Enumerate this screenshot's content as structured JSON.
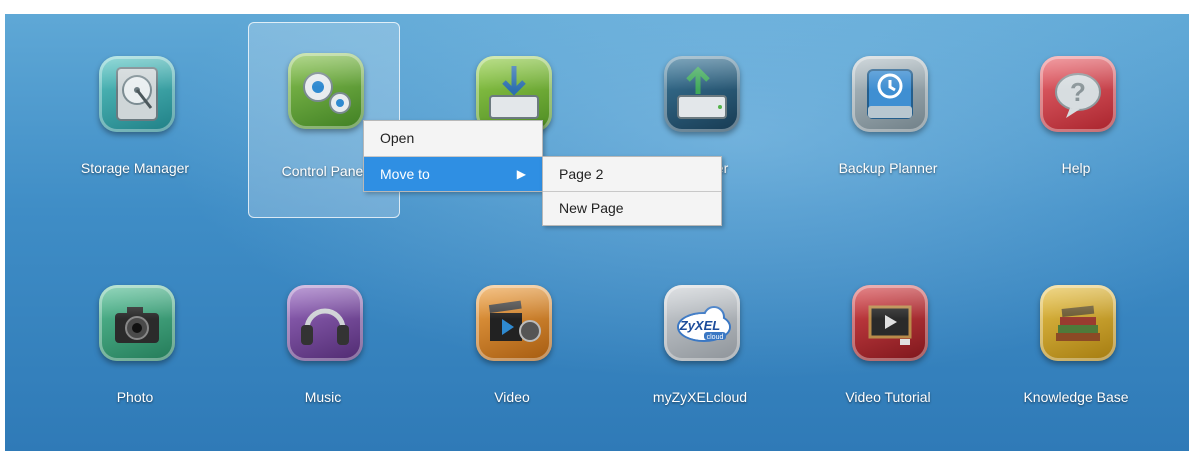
{
  "apps": [
    {
      "label": "Storage Manager",
      "icon": "hard-drive-icon",
      "color": "#2fa6a6"
    },
    {
      "label": "Control Panel",
      "icon": "gears-icon",
      "color": "#6aa83a",
      "selected": true
    },
    {
      "label": "",
      "icon": "download-drive-icon",
      "color": "#6fae2f"
    },
    {
      "label": "Manager",
      "icon": "upload-drive-icon",
      "color": "#2b5f7c"
    },
    {
      "label": "Backup Planner",
      "icon": "backup-disk-icon",
      "color": "#8fa1a9"
    },
    {
      "label": "Help",
      "icon": "help-bubble-icon",
      "color": "#d4454f"
    },
    {
      "label": "Photo",
      "icon": "camera-icon",
      "color": "#3aa57c"
    },
    {
      "label": "Music",
      "icon": "headphones-icon",
      "color": "#7b4aa1"
    },
    {
      "label": "Video",
      "icon": "film-clapper-icon",
      "color": "#d4811f"
    },
    {
      "label": "myZyXELcloud",
      "icon": "zyxel-cloud-icon",
      "color": "#a9acb1"
    },
    {
      "label": "Video Tutorial",
      "icon": "video-tutorial-icon",
      "color": "#b02a2f"
    },
    {
      "label": "Knowledge Base",
      "icon": "books-icon",
      "color": "#d2a526"
    }
  ],
  "context_menu": {
    "open_label": "Open",
    "move_to_label": "Move to",
    "arrow": "▶"
  },
  "submenu": {
    "items": [
      "Page 2",
      "New Page"
    ]
  },
  "zyxel_logo_text": "ZyXEL",
  "zyxel_logo_sub": "cloud"
}
